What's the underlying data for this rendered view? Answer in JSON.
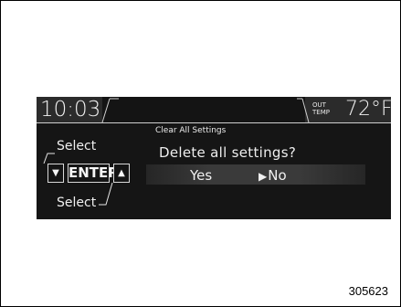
{
  "status": {
    "time": "10:03",
    "out_temp_label_line1": "OUT",
    "out_temp_label_line2": "TEMP",
    "temperature": "72°F"
  },
  "dialog": {
    "title": "Clear All Settings",
    "question": "Delete all settings?",
    "options": [
      "Yes",
      "No"
    ],
    "selected": "No",
    "selection_marker": "▶"
  },
  "controls": {
    "down_icon": "triangle-down-icon",
    "down_glyph": "▼",
    "enter_label": "ENTER",
    "up_icon": "triangle-up-icon",
    "up_glyph": "▲",
    "callout_top": "Select",
    "callout_bottom": "Select"
  },
  "figure": {
    "number": "305623"
  },
  "colors": {
    "display_background": "#151515",
    "text": "#f0f0f0",
    "highlight_bar": "#3a3a3a"
  }
}
